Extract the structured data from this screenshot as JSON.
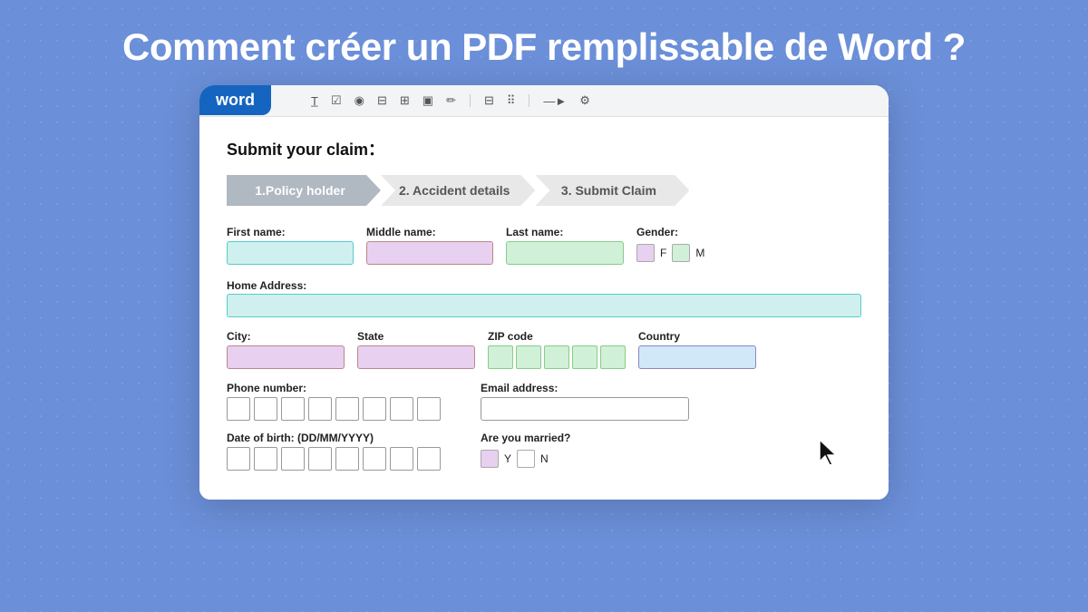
{
  "page": {
    "title": "Comment créer un PDF remplissable de Word ?",
    "background_color": "#6b8fd8"
  },
  "word_badge": {
    "label": "word"
  },
  "toolbar": {
    "icons": [
      {
        "name": "text-field-icon",
        "symbol": "T"
      },
      {
        "name": "checkbox-icon",
        "symbol": "☑"
      },
      {
        "name": "radio-icon",
        "symbol": "◉"
      },
      {
        "name": "richtext-icon",
        "symbol": "≡"
      },
      {
        "name": "table-icon",
        "symbol": "⊞"
      },
      {
        "name": "image-icon",
        "symbol": "⬛"
      },
      {
        "name": "edit-icon",
        "symbol": "✏"
      },
      {
        "name": "grid-icon",
        "symbol": "⊟"
      },
      {
        "name": "grid2-icon",
        "symbol": "⠿"
      },
      {
        "name": "arrow-icon",
        "symbol": "—►"
      },
      {
        "name": "settings-icon",
        "symbol": "⚙"
      }
    ]
  },
  "form": {
    "title": "Submit your claim：",
    "steps": [
      {
        "id": "step1",
        "label": "1.Policy holder",
        "active": true
      },
      {
        "id": "step2",
        "label": "2. Accident details",
        "active": false
      },
      {
        "id": "step3",
        "label": "3. Submit Claim",
        "active": false
      }
    ],
    "fields": {
      "first_name_label": "First name:",
      "middle_name_label": "Middle name:",
      "last_name_label": "Last name:",
      "gender_label": "Gender:",
      "gender_f": "F",
      "gender_m": "M",
      "home_address_label": "Home Address:",
      "city_label": "City:",
      "state_label": "State",
      "zip_label": "ZIP code",
      "country_label": "Country",
      "phone_label": "Phone number:",
      "email_label": "Email address:",
      "dob_label": "Date of birth: (DD/MM/YYYY)",
      "married_label": "Are you married?",
      "married_y": "Y",
      "married_n": "N"
    }
  }
}
